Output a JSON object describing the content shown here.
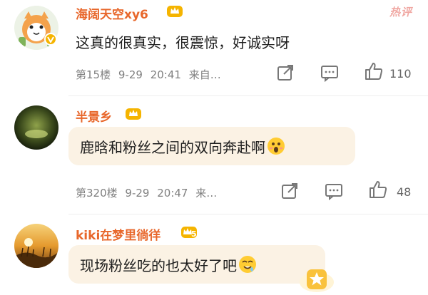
{
  "hot_label": "热评",
  "comments": [
    {
      "username": "海阔天空xy6",
      "text": "这真的很真实，很震惊，好诚实呀",
      "floor": "第15楼",
      "date": "9-29",
      "time": "20:41",
      "source": "来自…",
      "likes": "110"
    },
    {
      "username": "半景乡",
      "text": "鹿晗和粉丝之间的双向奔赴啊",
      "floor": "第320楼",
      "date": "9-29",
      "time": "20:47",
      "source": "来…",
      "likes": "48"
    },
    {
      "username": "kiki在梦里徜徉",
      "crown_level": "5",
      "text": "现场粉丝吃的也太好了吧"
    }
  ],
  "colors": {
    "username": "#e8672b",
    "meta": "#808080",
    "bubble": "#fbf2e4",
    "crown": "#f5b400"
  }
}
